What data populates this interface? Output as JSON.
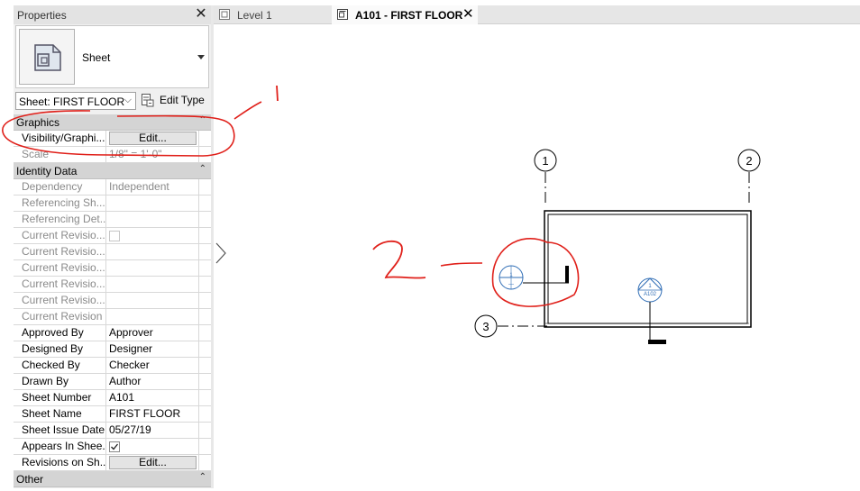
{
  "palette": {
    "title": "Properties",
    "close_glyph": "✕",
    "type_selector": {
      "icon": "sheet-type-icon",
      "name": "Sheet"
    },
    "instance_filter": {
      "value": "Sheet: FIRST FLOOR",
      "chevron": "⌵"
    },
    "edit_type_label": "Edit Type",
    "categories": {
      "graphics": {
        "label": "Graphics",
        "collapse_glyph": "⌃"
      },
      "identity": {
        "label": "Identity Data",
        "collapse_glyph": "⌃"
      },
      "other": {
        "label": "Other",
        "collapse_glyph": "⌃"
      }
    },
    "rows": {
      "visibility": {
        "label": "Visibility/Graphi...",
        "button": "Edit..."
      },
      "scale": {
        "label": "Scale",
        "value": "1/8\" = 1'-0\""
      },
      "dependency": {
        "label": "Dependency",
        "value": "Independent"
      },
      "ref_sheet": {
        "label": "Referencing Sh...",
        "value": ""
      },
      "ref_detail": {
        "label": "Referencing Det...",
        "value": ""
      },
      "cur_rev_1": {
        "label": "Current Revisio...",
        "value": ""
      },
      "cur_rev_2": {
        "label": "Current Revisio...",
        "value": ""
      },
      "cur_rev_3": {
        "label": "Current Revisio...",
        "value": ""
      },
      "cur_rev_4": {
        "label": "Current Revisio...",
        "value": ""
      },
      "cur_rev_5": {
        "label": "Current Revisio...",
        "value": ""
      },
      "cur_rev_6": {
        "label": "Current Revision",
        "value": ""
      },
      "approved": {
        "label": "Approved By",
        "value": "Approver"
      },
      "designed": {
        "label": "Designed By",
        "value": "Designer"
      },
      "checked": {
        "label": "Checked By",
        "value": "Checker"
      },
      "drawn": {
        "label": "Drawn By",
        "value": "Author"
      },
      "sheet_number": {
        "label": "Sheet Number",
        "value": "A101"
      },
      "sheet_name": {
        "label": "Sheet Name",
        "value": "FIRST FLOOR"
      },
      "issue_date": {
        "label": "Sheet Issue Date",
        "value": "05/27/19"
      },
      "appears": {
        "label": "Appears In Shee...",
        "checked": true
      },
      "revisions": {
        "label": "Revisions on Sh...",
        "button": "Edit..."
      }
    }
  },
  "tabs": [
    {
      "label": "Level 1",
      "icon": "floor-plan-view-icon",
      "active": false
    },
    {
      "label": "A101 - FIRST FLOOR",
      "icon": "sheet-view-icon",
      "active": true,
      "close_glyph": "✕"
    }
  ],
  "canvas": {
    "grids": [
      {
        "label": "1"
      },
      {
        "label": "2"
      },
      {
        "label": "3"
      }
    ],
    "section_marker": {
      "number": "1",
      "sheet": "—"
    },
    "elevation_marker": {
      "number": "1",
      "sheet": "A102"
    },
    "annotations": [
      {
        "label": "1"
      },
      {
        "label": "2"
      }
    ]
  },
  "colors": {
    "markup_red": "#e0201a",
    "view_tag_blue": "#2f6db5",
    "panel_bg": "#f0f0f0",
    "category_bg": "#d4d4d4"
  }
}
